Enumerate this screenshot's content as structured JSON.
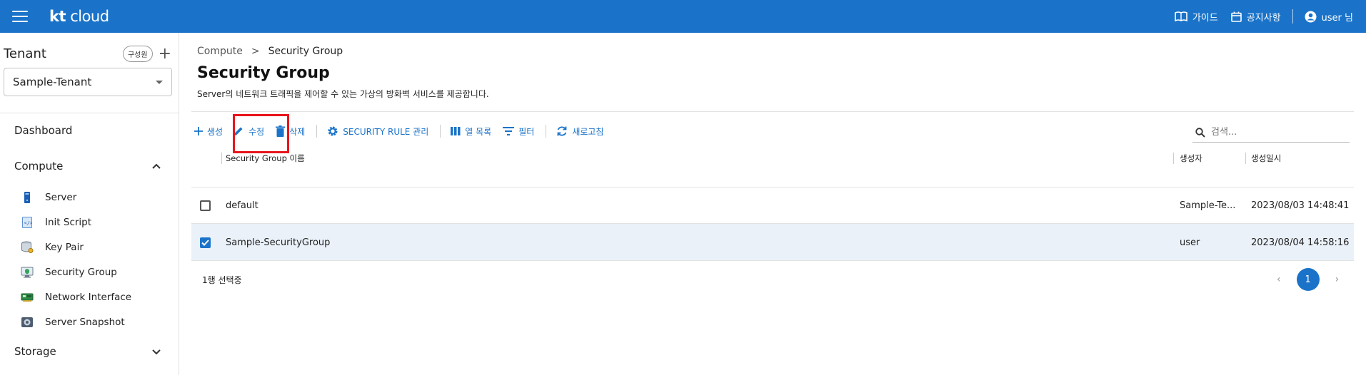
{
  "topbar": {
    "logo_kt": "kt",
    "logo_cloud": "cloud",
    "guide_label": "가이드",
    "notice_label": "공지사항",
    "user_label": "user 님"
  },
  "sidebar": {
    "tenant_title": "Tenant",
    "member_button": "구성원",
    "add_symbol": "+",
    "tenant_value": "Sample-Tenant",
    "dashboard": "Dashboard",
    "compute": "Compute",
    "storage": "Storage",
    "compute_items": [
      {
        "label": "Server",
        "icon": "server-icon"
      },
      {
        "label": "Init Script",
        "icon": "script-icon"
      },
      {
        "label": "Key Pair",
        "icon": "key-pair-icon"
      },
      {
        "label": "Security Group",
        "icon": "security-group-icon"
      },
      {
        "label": "Network Interface",
        "icon": "network-interface-icon"
      },
      {
        "label": "Server Snapshot",
        "icon": "snapshot-icon"
      }
    ]
  },
  "breadcrumb": {
    "parent": "Compute",
    "separator": ">",
    "current": "Security Group"
  },
  "page": {
    "title": "Security Group",
    "description": "Server의 네트워크 트래픽을 제어할 수 있는 가상의 방화벽 서비스를 제공합니다."
  },
  "toolbar": {
    "create": "생성",
    "edit": "수정",
    "delete": "삭제",
    "security_rule": "SECURITY RULE 관리",
    "columns": "열 목록",
    "filter": "필터",
    "refresh": "새로고침",
    "search_placeholder": "검색..."
  },
  "table": {
    "headers": {
      "name": "Security Group 이름",
      "creator": "생성자",
      "created_at": "생성일시"
    },
    "rows": [
      {
        "name": "default",
        "creator": "Sample-Te...",
        "created_at": "2023/08/03 14:48:41",
        "selected": false
      },
      {
        "name": "Sample-SecurityGroup",
        "creator": "user",
        "created_at": "2023/08/04 14:58:16",
        "selected": true
      }
    ]
  },
  "footer": {
    "selection_text": "1행 선택중",
    "current_page": "1",
    "prev": "‹",
    "next": "›"
  },
  "colors": {
    "primary": "#1a73c9",
    "highlight": "#e8151b",
    "selected_row": "#eaf1f9"
  }
}
